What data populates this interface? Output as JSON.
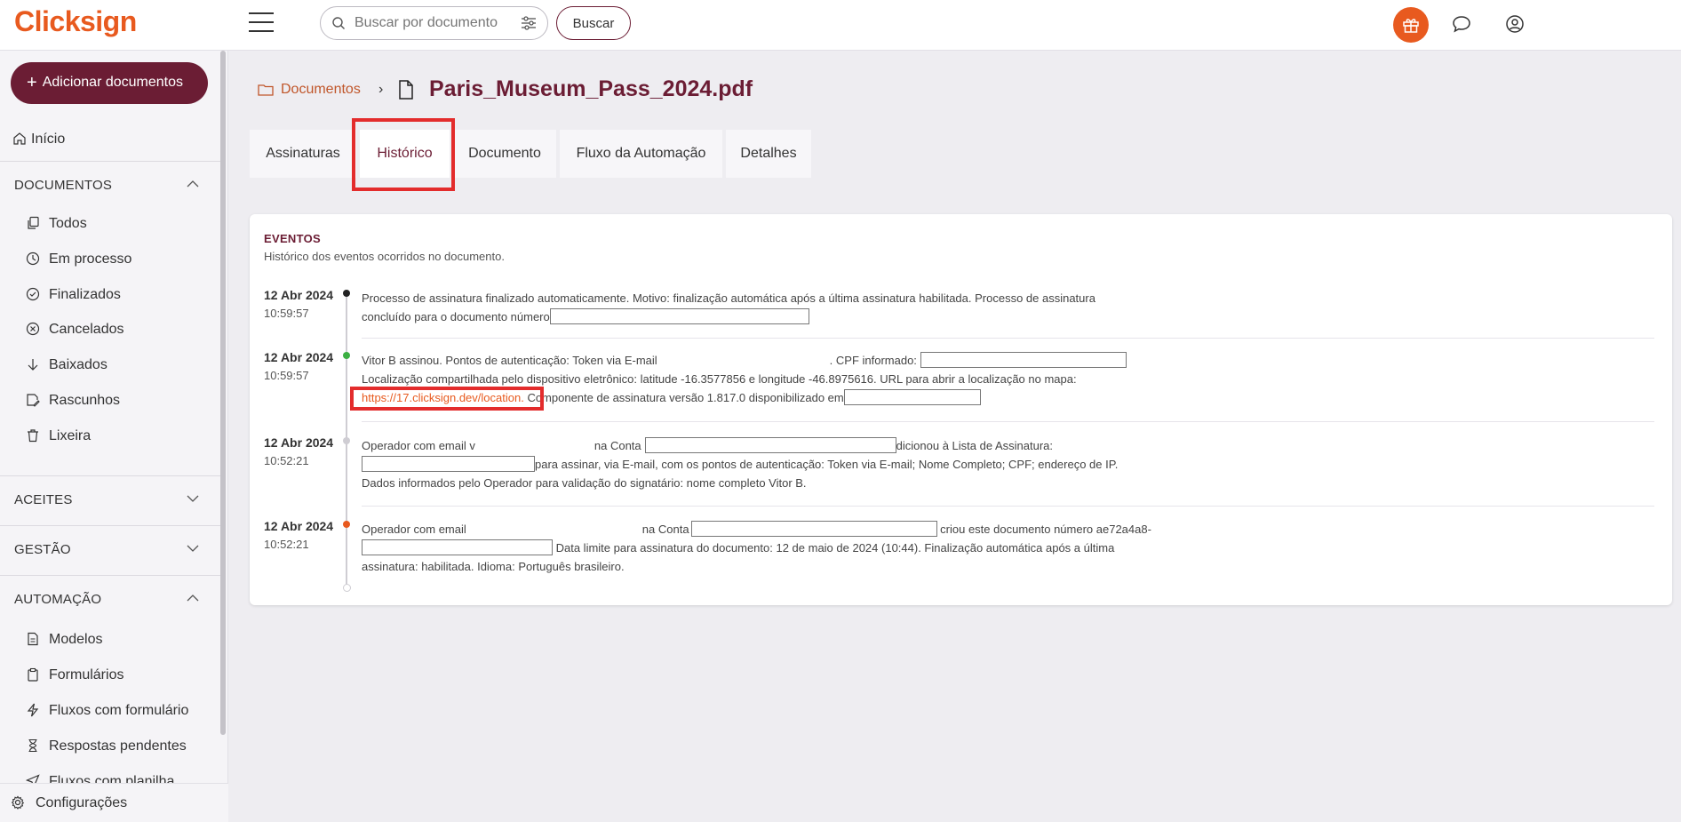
{
  "app": {
    "logo": "Clicksign"
  },
  "header": {
    "search_placeholder": "Buscar por documento",
    "search_button": "Buscar"
  },
  "sidebar": {
    "add_button": "Adicionar documentos",
    "home": "Início",
    "sections": {
      "documentos": "DOCUMENTOS",
      "aceites": "ACEITES",
      "gestao": "GESTÃO",
      "automacao": "AUTOMAÇÃO"
    },
    "doc_items": [
      "Todos",
      "Em processo",
      "Finalizados",
      "Cancelados",
      "Baixados",
      "Rascunhos",
      "Lixeira"
    ],
    "auto_items": [
      "Modelos",
      "Formulários",
      "Fluxos com formulário",
      "Respostas pendentes",
      "Fluxos com planilha"
    ],
    "footer": "Configurações"
  },
  "breadcrumb": {
    "parent": "Documentos",
    "separator": "›",
    "title": "Paris_Museum_Pass_2024.pdf"
  },
  "tabs": [
    "Assinaturas",
    "Histórico",
    "Documento",
    "Fluxo da Automação",
    "Detalhes"
  ],
  "events_card": {
    "title": "EVENTOS",
    "subtitle": "Histórico dos eventos ocorridos no documento.",
    "events": [
      {
        "date": "12 Abr 2024",
        "time": "10:59:57",
        "dot_color": "#222222",
        "line1": "Processo de assinatura finalizado automaticamente. Motivo: finalização automática após a última assinatura habilitada. Processo de assinatura",
        "line2": "concluído para o documento número"
      },
      {
        "date": "12 Abr 2024",
        "time": "10:59:57",
        "dot_color": "#3cb043",
        "line1a": "Vitor B assinou. Pontos de autenticação: Token via E-mail",
        "line1b": ". CPF informado:",
        "line2": "Localização compartilhada pelo dispositivo eletrônico: latitude -16.3577856 e longitude -46.8975616. URL para abrir a localização no mapa:",
        "link": "https://17.clicksign.dev/location.",
        "line3": " Componente de assinatura versão 1.817.0 disponibilizado em"
      },
      {
        "date": "12 Abr 2024",
        "time": "10:52:21",
        "dot_color": "#cfcdd3",
        "line1a": "Operador com email v",
        "line1b": "na Conta",
        "line1c": "dicionou à Lista de Assinatura:",
        "line2": "para assinar, via E-mail, com os pontos de autenticação: Token via E-mail; Nome Completo; CPF; endereço de IP.",
        "line3": "Dados informados pelo Operador para validação do signatário: nome completo Vitor B."
      },
      {
        "date": "12 Abr 2024",
        "time": "10:52:21",
        "dot_color": "#e85a1f",
        "line1a": "Operador com email",
        "line1b": "na Conta",
        "line1c": " criou este documento número ae72a4a8-",
        "line2": " Data limite para assinatura do documento: 12 de maio de 2024 (10:44). Finalização automática após a última",
        "line3": "assinatura: habilitada. Idioma: Português brasileiro."
      }
    ]
  }
}
